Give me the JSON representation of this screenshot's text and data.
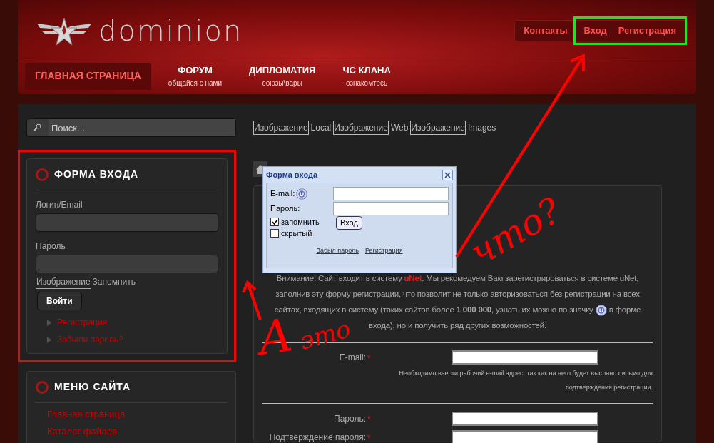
{
  "header": {
    "logo": "dominion",
    "top_links": [
      "Контакты"
    ],
    "highlighted_links": [
      "Вход",
      "Регистрация"
    ],
    "nav": [
      {
        "title": "ГЛАВНАЯ СТРАНИЦА",
        "selected": true
      },
      {
        "title": "ФОРУМ",
        "subtitle": "общайся с нами",
        "selected": false
      },
      {
        "title": "ДИПЛОМАТИЯ",
        "subtitle": "союзы\\вары",
        "selected": false
      },
      {
        "title": "ЧС КЛАНА",
        "subtitle": "ознакомтесь",
        "selected": false
      }
    ]
  },
  "search": {
    "placeholder": "Поиск..."
  },
  "image_links": [
    {
      "alt": "Изображение",
      "label": "Local"
    },
    {
      "alt": "Изображение",
      "label": "Web"
    },
    {
      "alt": "Изображение",
      "label": "Images"
    }
  ],
  "login_block": {
    "title": "ФОРМА ВХОДА",
    "highlighted": true,
    "fields": [
      {
        "label": "Логин/Email"
      },
      {
        "label": "Пароль"
      }
    ],
    "remember": {
      "alt": "Изображение",
      "label": "Запомнить"
    },
    "button": "Войти",
    "links": [
      "Регистрация",
      "Забыли пароль?"
    ]
  },
  "menu_block": {
    "title": "МЕНЮ САЙТА",
    "items": [
      "Главная страница",
      "Каталог файлов"
    ]
  },
  "dialog": {
    "title": "Форма входа",
    "fields": [
      {
        "label": "E-mail:",
        "unet_icon": true
      },
      {
        "label": "Пароль:",
        "unet_icon": false
      }
    ],
    "checkboxes": [
      {
        "label": "запомнить",
        "checked": true
      },
      {
        "label": "скрытый",
        "checked": false
      }
    ],
    "button": "Вход",
    "links": [
      "Забыл пароль",
      "Регистрация"
    ],
    "separator": "·"
  },
  "notice": [
    {
      "kind": "plain",
      "text": "Внимание! Сайт входит в систему "
    },
    {
      "kind": "accent",
      "text": "uNet"
    },
    {
      "kind": "plain",
      "text": ". Мы рекомедуем Вам зарегистрироваться в системе uNet, заполнив эту форму регистрации, что позволит не только авторизоваться без регистрации на всех сайтах, входящих в систему (таких сайтов более **1 000 000**, узнать их можно по значку "
    },
    {
      "kind": "icon"
    },
    {
      "kind": "plain",
      "text": " в форме входа), но и получить ряд других возможностей."
    }
  ],
  "form": [
    {
      "label": "E-mail:",
      "required_mark": "*",
      "hint": "Необходимо ввести рабочий e-mail адрес, так как на него будет выслано письмо для подтверждения регистрации."
    },
    {
      "label": "Пароль:",
      "required_mark": "*"
    },
    {
      "label": "Подтверждение пароля:",
      "required_mark": "*"
    }
  ],
  "annotation": {
    "words": [
      "А",
      "это",
      "что?"
    ]
  }
}
